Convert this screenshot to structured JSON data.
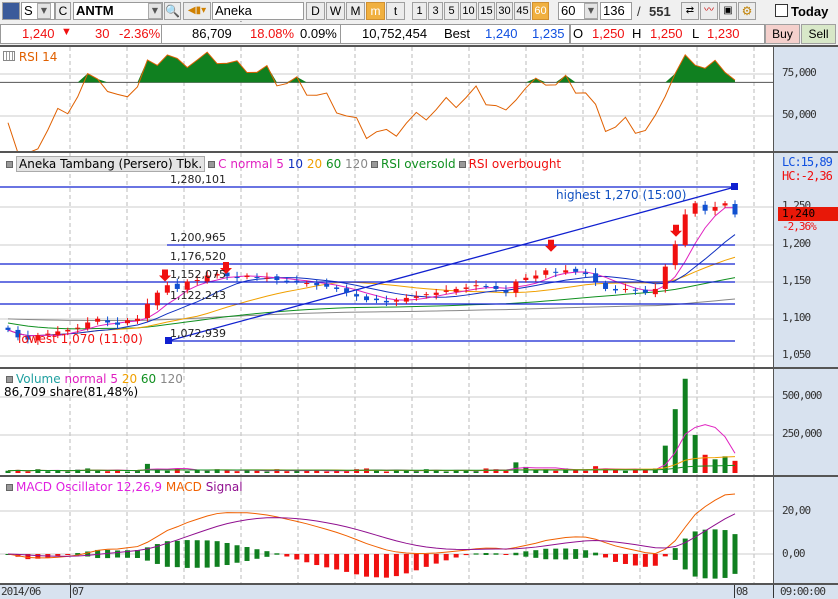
{
  "toolbar": {
    "market": "S",
    "c_label": "C",
    "symbol": "ANTM",
    "name": "Aneka Tambang",
    "periods": [
      "D",
      "W",
      "M",
      "m",
      "t"
    ],
    "active_period": "m",
    "intervals": [
      "1",
      "3",
      "5",
      "10",
      "15",
      "30",
      "45",
      "60"
    ],
    "active_interval": "60",
    "interval_select": "60",
    "bar_count": "136",
    "total_sep": "/",
    "total": "551",
    "today_label": "Today"
  },
  "info": {
    "price": "1,240",
    "change_arrow": "▼",
    "change": "30",
    "change_pct": "-2.36%",
    "volume": "86,709",
    "vol_pct": "18.08%",
    "turnover_pct": "0.09%",
    "value": "10,752,454",
    "best_label": "Best",
    "best_bid": "1,240",
    "best_ask": "1,235",
    "o_label": "O",
    "open": "1,250",
    "h_label": "H",
    "high": "1,250",
    "l_label": "L",
    "low": "1,230",
    "buy": "Buy",
    "sell": "Sell"
  },
  "rsi": {
    "label": "RSI 14",
    "ticks": [
      "75,000",
      "50,000"
    ]
  },
  "main": {
    "title": "Aneka Tambang (Persero) Tbk.",
    "ma_label": "C normal",
    "ma": [
      "5",
      "10",
      "20",
      "60",
      "120"
    ],
    "oversold": "RSI oversold",
    "overbought": "RSI overbought",
    "lc": "LC:15,89",
    "hc": "HC:-2,36",
    "last": "1,240",
    "last_pct": "-2,36%",
    "ticks": [
      "1,250",
      "1,200",
      "1,150",
      "1,100",
      "1,050"
    ],
    "levels": [
      "1,280,101",
      "1,200,965",
      "1,176,520",
      "1,152,075",
      "1,122,243",
      "1,072,939"
    ],
    "highest": "highest 1,270 (15:00)",
    "lowest": "lowest 1,070 (11:00)"
  },
  "volume": {
    "label": "Volume",
    "ma_label": "normal",
    "ma": [
      "5",
      "20",
      "60",
      "120"
    ],
    "share": "86,709 share(81,48%)",
    "ticks": [
      "500,000",
      "250,000"
    ]
  },
  "macd": {
    "label": "MACD Oscillator 12,26,9",
    "macd": "MACD",
    "signal": "Signal",
    "ticks": [
      "20,00",
      "0,00"
    ]
  },
  "time": {
    "labels": [
      "2014/06",
      "07",
      "08"
    ],
    "clock": "09:00:00"
  },
  "colors": {
    "up": "#f01010",
    "down": "#1050d0",
    "ma5": "#e020c0",
    "ma10": "#1030c0",
    "ma20": "#f0a000",
    "ma60": "#109020",
    "ma120": "#888888",
    "axis_bg": "#d8e2ef"
  },
  "chart_data": {
    "type": "candlestick",
    "ylim": [
      1040,
      1290
    ],
    "closes": [
      1085,
      1075,
      1072,
      1078,
      1080,
      1083,
      1085,
      1088,
      1095,
      1100,
      1095,
      1092,
      1098,
      1100,
      1120,
      1135,
      1145,
      1140,
      1150,
      1152,
      1158,
      1160,
      1157,
      1155,
      1158,
      1155,
      1155,
      1152,
      1150,
      1150,
      1148,
      1145,
      1143,
      1140,
      1135,
      1130,
      1125,
      1125,
      1122,
      1125,
      1128,
      1130,
      1133,
      1135,
      1138,
      1140,
      1142,
      1145,
      1143,
      1140,
      1135,
      1150,
      1155,
      1158,
      1165,
      1162,
      1165,
      1163,
      1160,
      1150,
      1140,
      1138,
      1140,
      1138,
      1135,
      1140,
      1170,
      1200,
      1240,
      1255,
      1245,
      1250,
      1255,
      1240
    ],
    "volumes": [
      15,
      20,
      10,
      25,
      12,
      18,
      10,
      22,
      30,
      15,
      12,
      20,
      10,
      18,
      60,
      25,
      15,
      30,
      12,
      20,
      15,
      25,
      18,
      12,
      20,
      15,
      10,
      25,
      12,
      18,
      15,
      20,
      10,
      15,
      12,
      25,
      30,
      15,
      10,
      20,
      15,
      12,
      25,
      18,
      10,
      20,
      15,
      12,
      30,
      25,
      15,
      70,
      40,
      20,
      25,
      15,
      30,
      20,
      15,
      45,
      30,
      20,
      15,
      20,
      25,
      30,
      180,
      420,
      620,
      250,
      120,
      90,
      110,
      80
    ]
  }
}
